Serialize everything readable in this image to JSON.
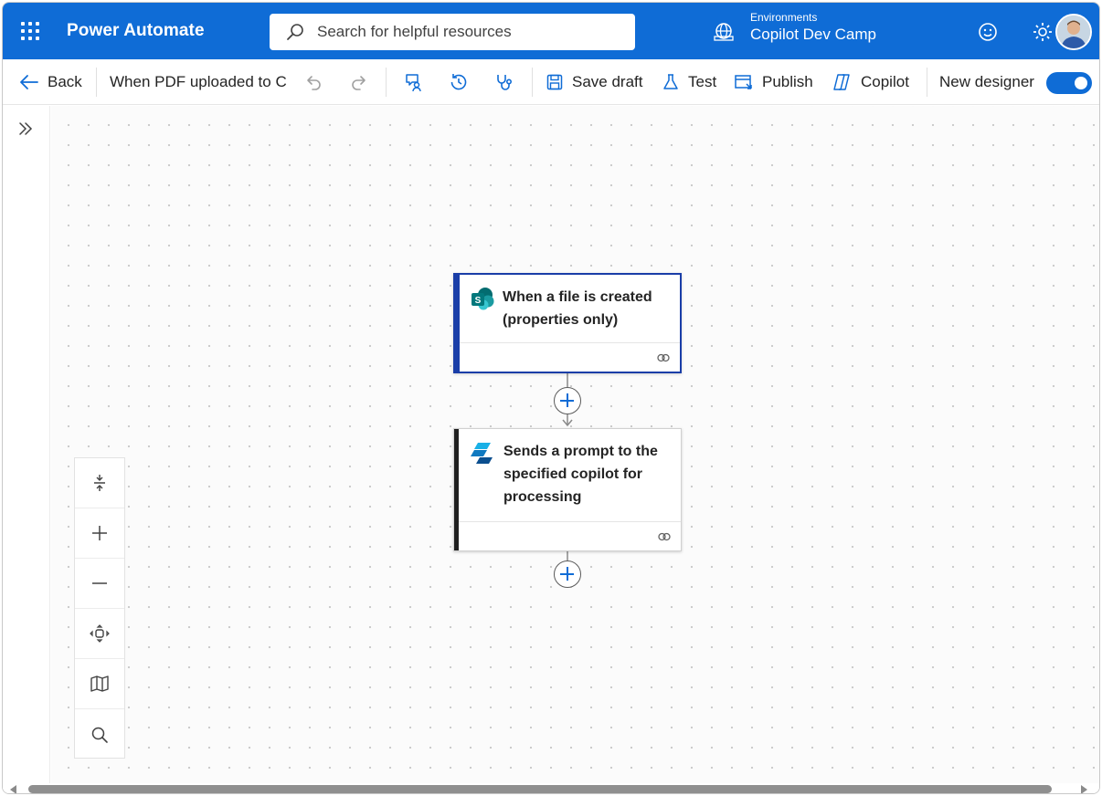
{
  "header": {
    "app_name": "Power Automate",
    "search_placeholder": "Search for helpful resources",
    "environment_label": "Environments",
    "environment_name": "Copilot Dev Camp",
    "brand_color": "#0f6cd6"
  },
  "toolbar": {
    "back_label": "Back",
    "flow_name": "When PDF uploaded to C",
    "save_draft_label": "Save draft",
    "test_label": "Test",
    "publish_label": "Publish",
    "copilot_label": "Copilot",
    "new_designer_label": "New designer",
    "new_designer_enabled": true
  },
  "flow": {
    "steps": [
      {
        "title": "When a file is created (properties only)",
        "icon": "sharepoint-icon",
        "selected": true
      },
      {
        "title": "Sends a prompt to the specified copilot for processing",
        "icon": "copilot-studio-icon",
        "selected": false
      }
    ]
  },
  "zoom_controls": [
    "fit-vertical-icon",
    "zoom-in-icon",
    "zoom-out-icon",
    "fit-view-icon",
    "minimap-icon",
    "search-icon"
  ]
}
